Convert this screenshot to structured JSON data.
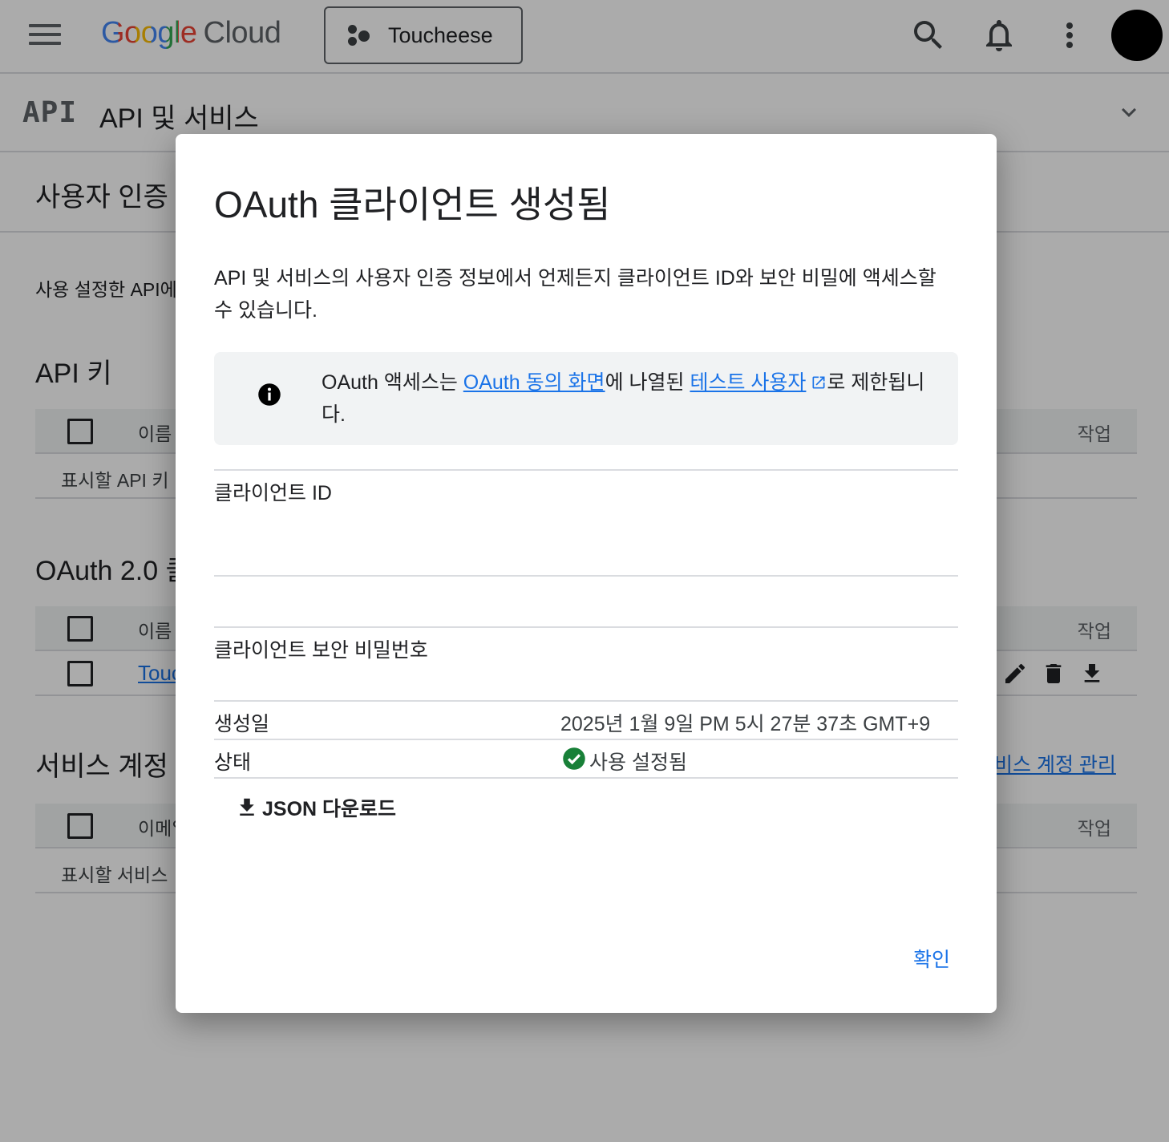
{
  "header": {
    "logo_google": "Google",
    "logo_cloud": "Cloud",
    "project_name": "Toucheese"
  },
  "subbar": {
    "badge": "API",
    "title": "API 및 서비스"
  },
  "page": {
    "section_title": "사용자 인증",
    "intro_text": "사용 설정한 API에",
    "api_keys": {
      "title": "API 키",
      "col_name": "이름",
      "col_actions": "작업",
      "empty_text": "표시할 API 키"
    },
    "oauth": {
      "title": "OAuth 2.0 클",
      "col_name": "이름",
      "col_actions": "작업",
      "row_link": "Touc"
    },
    "service_accounts": {
      "title": "서비스 계정",
      "manage_link": "비스 계정 관리",
      "col_email": "이메일",
      "col_actions": "작업",
      "empty_text": "표시할 서비스"
    }
  },
  "dialog": {
    "title": "OAuth 클라이언트 생성됨",
    "description": "API 및 서비스의 사용자 인증 정보에서 언제든지 클라이언트 ID와 보안 비밀에 액세스할 수 있습니다.",
    "info": {
      "prefix": "OAuth 액세스는 ",
      "link1": "OAuth 동의 화면",
      "middle": "에 나열된 ",
      "link2": "테스트 사용자",
      "suffix": "로 제한됩니다."
    },
    "client_id_label": "클라이언트 ID",
    "client_id_value": "",
    "client_secret_label": "클라이언트 보안 비밀번호",
    "client_secret_value": "",
    "created_label": "생성일",
    "created_value": "2025년 1월 9일 PM 5시 27분 37초 GMT+9",
    "status_label": "상태",
    "status_value": "사용 설정됨",
    "json_button": "JSON 다운로드",
    "ok_button": "확인"
  },
  "colors": {
    "accent": "#1a73e8",
    "status_ok": "#188038",
    "scrim": "#00000054"
  },
  "icons": [
    "menu-icon",
    "search-icon",
    "bell-icon",
    "more-vert-icon",
    "chevron-down-icon",
    "info-icon",
    "external-link-icon",
    "check-circle-icon",
    "download-icon",
    "edit-icon",
    "delete-icon"
  ]
}
